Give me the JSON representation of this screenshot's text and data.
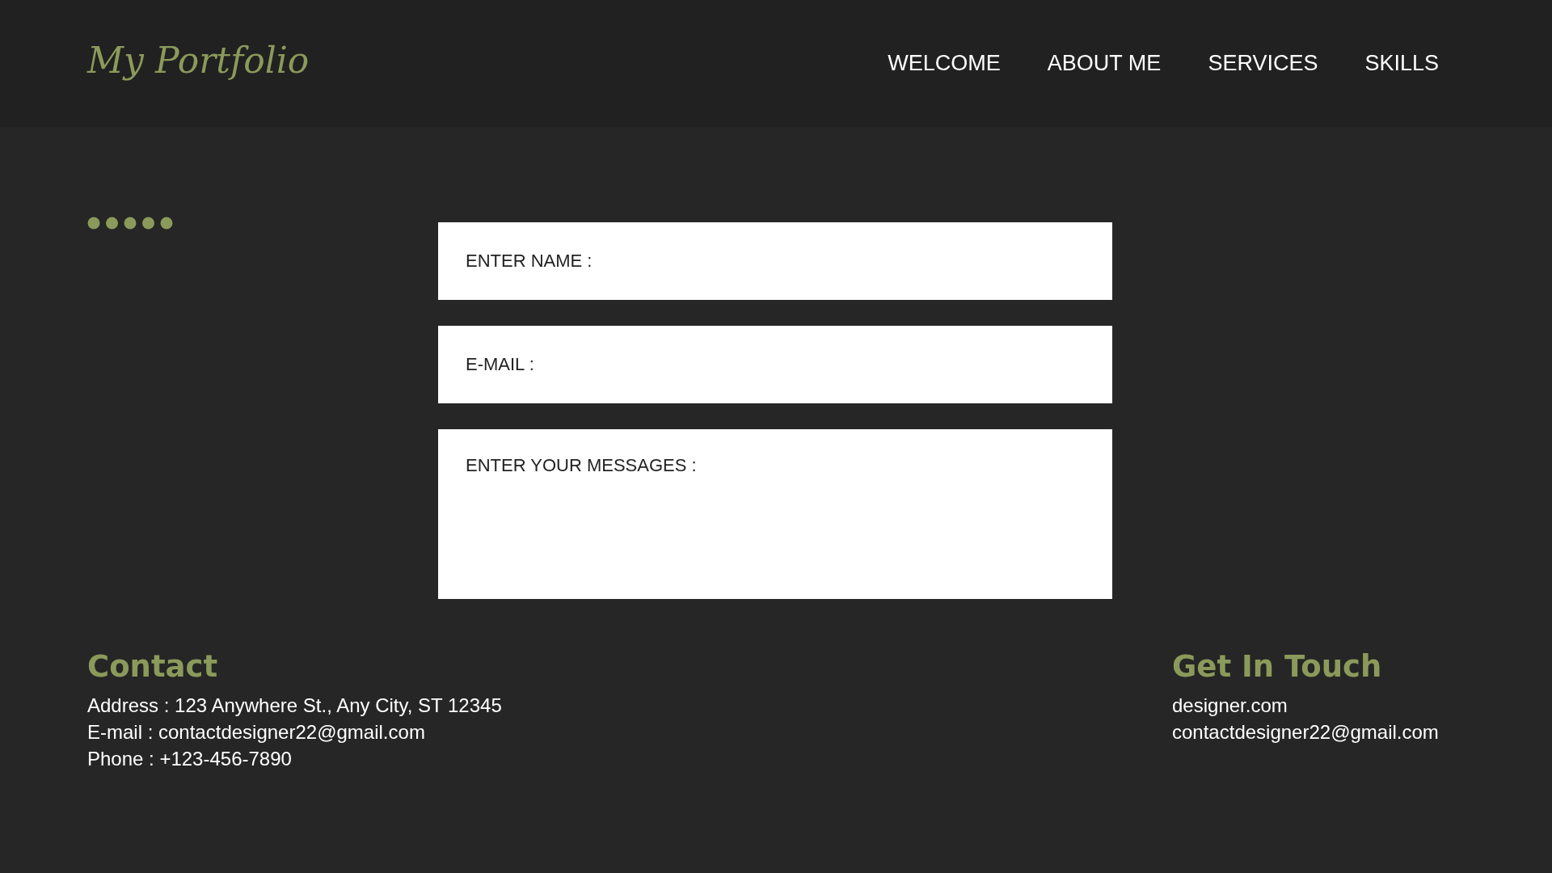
{
  "header": {
    "logo": "My Portfolio",
    "nav": [
      {
        "label": "WELCOME"
      },
      {
        "label": "ABOUT ME"
      },
      {
        "label": "SERVICES"
      },
      {
        "label": "SKILLS"
      }
    ]
  },
  "form": {
    "fields": [
      {
        "kind": "line",
        "placeholder": "ENTER NAME :"
      },
      {
        "kind": "line",
        "placeholder": "E-MAIL :"
      },
      {
        "kind": "area",
        "placeholder": "ENTER YOUR MESSAGES :"
      }
    ]
  },
  "contact": {
    "title": "Contact",
    "lines": [
      "Address : 123 Anywhere St., Any City, ST 12345",
      "E-mail : contactdesigner22@gmail.com",
      "Phone : +123-456-7890"
    ]
  },
  "get_in_touch": {
    "title": "Get In Touch",
    "lines": [
      "designer.com",
      "contactdesigner22@gmail.com"
    ]
  }
}
